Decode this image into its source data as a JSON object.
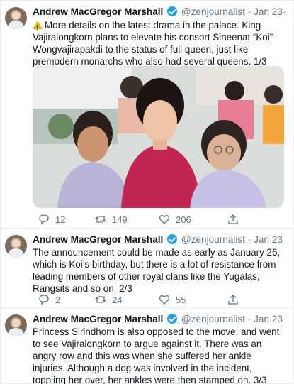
{
  "tweets": [
    {
      "author": "Andrew MacGregor Marshall",
      "handle": "@zenjournalist",
      "date": "Jan 23",
      "text": "More details on the latest drama in the palace. King Vajiralongkorn plans to elevate his consort Sineenat “Koi” Wongvajirapakdi to the status of full queen, just like premodern monarchs who also had several queens. 1/3",
      "warn_icon": "warning-icon",
      "replies": "12",
      "retweets": "149",
      "likes": "206"
    },
    {
      "author": "Andrew MacGregor Marshall",
      "handle": "@zenjournalist",
      "date": "Jan 23",
      "text": "The announcement could be made as early as January 26, which is Koi’s birthday, but there is a lot of resistance from leading members of other royal clans like the Yugalas, Rangsits and so on. 2/3",
      "replies": "2",
      "retweets": "24",
      "likes": "55"
    },
    {
      "author": "Andrew MacGregor Marshall",
      "handle": "@zenjournalist",
      "date": "Jan 23",
      "text": "Princess Sirindhorn is also opposed to the move, and went to see Vajiralongkorn to argue against it. There was an angry row and this was when she suffered her ankle injuries. Although a dog was involved in the incident, toppling her over, her ankles were then stamped on. 3/3"
    }
  ],
  "separator": "·",
  "colors": {
    "verified": "#1da1f2",
    "muted": "#657786",
    "dress": "#c2254f"
  }
}
